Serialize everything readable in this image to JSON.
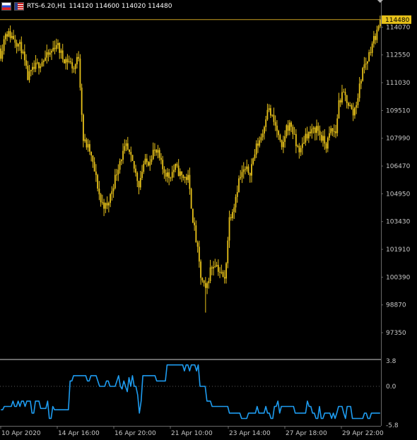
{
  "header": {
    "symbol": "RTS-6.20,H1",
    "quote": "114120 114600 114020 114480"
  },
  "colors": {
    "background": "#000000",
    "candle": "#e8c21a",
    "indicator": "#1e9cf0",
    "axis_text": "#c8c8c8",
    "separator": "#d0d0d0",
    "price_line": "#c8a020"
  },
  "chart_data": [
    {
      "type": "candlestick",
      "symbol": "RTS-6.20",
      "timeframe": "H1",
      "current_price": "114480",
      "y_ticks": [
        "114070",
        "112550",
        "111030",
        "109510",
        "107990",
        "106470",
        "104950",
        "103430",
        "101910",
        "100390",
        "98870",
        "97350"
      ],
      "ylim": [
        96000,
        115400
      ],
      "x_ticks": [
        "10 Apr 2020",
        "14 Apr 16:00",
        "16 Apr 20:00",
        "21 Apr 10:00",
        "23 Apr 14:00",
        "27 Apr 18:00",
        "29 Apr 22:00"
      ],
      "close_path": [
        [
          0,
          112600
        ],
        [
          3,
          113800
        ],
        [
          8,
          113500
        ],
        [
          13,
          112900
        ],
        [
          17,
          111300
        ],
        [
          22,
          111900
        ],
        [
          27,
          112300
        ],
        [
          31,
          112600
        ],
        [
          35,
          113200
        ],
        [
          39,
          112400
        ],
        [
          43,
          112200
        ],
        [
          46,
          111800
        ],
        [
          49,
          112500
        ],
        [
          52,
          107900
        ],
        [
          56,
          107300
        ],
        [
          60,
          105800
        ],
        [
          63,
          104500
        ],
        [
          67,
          104200
        ],
        [
          71,
          105500
        ],
        [
          75,
          106800
        ],
        [
          79,
          107500
        ],
        [
          83,
          106600
        ],
        [
          87,
          105500
        ],
        [
          90,
          106600
        ],
        [
          93,
          106700
        ],
        [
          96,
          107300
        ],
        [
          99,
          107100
        ],
        [
          102,
          106300
        ],
        [
          106,
          105900
        ],
        [
          110,
          106400
        ],
        [
          114,
          105900
        ],
        [
          118,
          105800
        ],
        [
          121,
          103600
        ],
        [
          124,
          101800
        ],
        [
          126,
          100400
        ],
        [
          129,
          99600
        ],
        [
          132,
          100800
        ],
        [
          135,
          101200
        ],
        [
          138,
          100700
        ],
        [
          141,
          100200
        ],
        [
          144,
          103600
        ],
        [
          147,
          104400
        ],
        [
          150,
          105700
        ],
        [
          153,
          106200
        ],
        [
          157,
          106200
        ],
        [
          161,
          107500
        ],
        [
          165,
          108300
        ],
        [
          168,
          109700
        ],
        [
          171,
          109100
        ],
        [
          174,
          108400
        ],
        [
          177,
          107300
        ],
        [
          180,
          108600
        ],
        [
          183,
          108700
        ],
        [
          186,
          107600
        ],
        [
          189,
          107300
        ],
        [
          192,
          108200
        ],
        [
          196,
          108300
        ],
        [
          199,
          108600
        ],
        [
          202,
          108000
        ],
        [
          205,
          107600
        ],
        [
          208,
          108400
        ],
        [
          211,
          108300
        ],
        [
          213,
          110000
        ],
        [
          216,
          110400
        ],
        [
          219,
          109900
        ],
        [
          222,
          109300
        ],
        [
          225,
          110300
        ],
        [
          228,
          111800
        ],
        [
          231,
          112300
        ],
        [
          234,
          113200
        ],
        [
          237,
          113800
        ],
        [
          240,
          114480
        ]
      ],
      "extremes": {
        "high": 114700,
        "low": 98450
      }
    },
    {
      "type": "line",
      "name": "indicator",
      "y_ticks": [
        "3.8",
        "0.0",
        "-5.8"
      ],
      "ylim": [
        -5.8,
        3.8
      ],
      "zero_level": 0.0,
      "values": [
        -3.5,
        -3.5,
        -3.0,
        -3.0,
        -3.0,
        -3.0,
        -3.0,
        -2.2,
        -3.0,
        -3.0,
        -2.2,
        -3.0,
        -2.2,
        -2.2,
        -3.0,
        -2.2,
        -2.2,
        -2.2,
        -4.0,
        -4.0,
        -2.2,
        -2.2,
        -2.2,
        -3.3,
        -3.3,
        -3.3,
        -3.3,
        -2.2,
        -4.8,
        -4.8,
        -3.0,
        -3.5,
        -3.5,
        -3.5,
        -3.5,
        -3.5,
        -3.5,
        -3.5,
        -3.5,
        -3.5,
        0.8,
        0.8,
        1.6,
        1.6,
        1.6,
        1.6,
        1.6,
        1.6,
        1.6,
        1.6,
        0.8,
        0.8,
        1.6,
        1.6,
        1.6,
        1.6,
        0.8,
        0.0,
        0.0,
        0.0,
        0.0,
        0.8,
        0.8,
        0.0,
        0.0,
        0.0,
        0.0,
        0.8,
        1.6,
        0.0,
        -0.4,
        0.8,
        0.0,
        -0.8,
        1.3,
        0.0,
        1.6,
        0.0,
        0.0,
        -1.3,
        -4.0,
        -2.2,
        1.6,
        1.6,
        1.6,
        1.6,
        1.6,
        1.6,
        1.6,
        1.6,
        0.8,
        0.8,
        0.8,
        0.8,
        0.8,
        0.8,
        3.2,
        3.2,
        3.2,
        3.2,
        3.2,
        3.2,
        3.2,
        3.2,
        3.2,
        3.2,
        2.3,
        3.2,
        3.2,
        2.3,
        3.2,
        3.2,
        3.2,
        2.3,
        3.2,
        0.0,
        0.0,
        0.0,
        0.0,
        -2.2,
        -2.2,
        -2.2,
        -3.0,
        -3.0,
        -3.0,
        -3.0,
        -3.0,
        -3.0,
        -3.0,
        -3.0,
        -3.0,
        -3.0,
        -4.0,
        -4.0,
        -4.0,
        -4.0,
        -4.0,
        -4.0,
        -4.0,
        -4.8,
        -4.8,
        -4.8,
        -4.8,
        -4.0,
        -4.0,
        -4.0,
        -4.0,
        -4.0,
        -3.0,
        -4.0,
        -4.0,
        -4.0,
        -4.0,
        -3.0,
        -4.0,
        -4.0,
        -4.8,
        -4.8,
        -3.0,
        -3.0,
        -2.2,
        -4.0,
        -3.0,
        -3.0,
        -3.0,
        -3.0,
        -3.0,
        -3.0,
        -3.0,
        -3.0,
        -4.0,
        -4.0,
        -4.0,
        -4.0,
        -4.0,
        -4.0,
        -4.0,
        -2.2,
        -3.0,
        -3.0,
        -4.0,
        -4.0,
        -4.8,
        -4.8,
        -3.0,
        -4.8,
        -4.8,
        -4.0,
        -4.0,
        -4.0,
        -4.0,
        -4.8,
        -4.0,
        -4.8,
        -4.0,
        -3.0,
        -3.0,
        -3.0,
        -4.0,
        -4.8,
        -3.0,
        -3.0,
        -3.0,
        -4.8,
        -4.8,
        -4.8,
        -4.8,
        -4.8,
        -4.8,
        -4.8,
        -4.0,
        -4.0,
        -4.8,
        -4.8,
        -4.0,
        -4.0,
        -4.0,
        -4.0,
        -4.0,
        -4.0
      ]
    }
  ]
}
